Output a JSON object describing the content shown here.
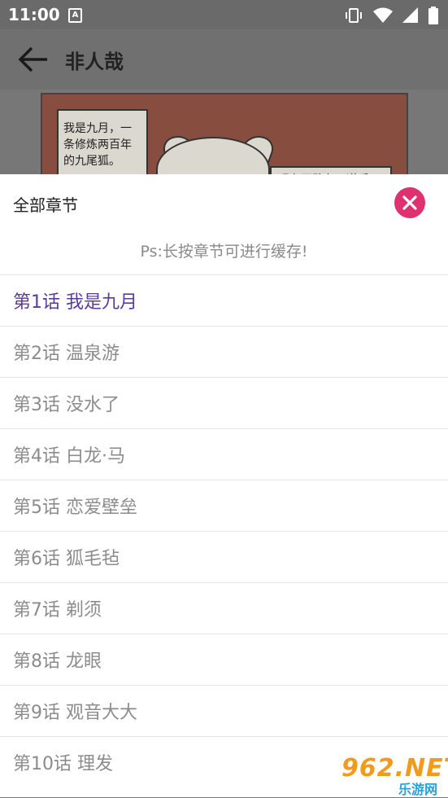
{
  "status_bar": {
    "time": "11:00",
    "notification_glyph": "A"
  },
  "app_bar": {
    "title": "非人哉"
  },
  "comic": {
    "bubble_lines": [
      "我是九月，一",
      "条修炼两百年",
      "的九尾狐。"
    ],
    "right_bubble_text": "现在不敢九天道后"
  },
  "sheet": {
    "title": "全部章节",
    "hint": "Ps:长按章节可进行缓存!",
    "chapters": [
      "第1话 我是九月",
      "第2话 温泉游",
      "第3话 没水了",
      "第4话 白龙·马",
      "第5话 恋爱壁垒",
      "第6话 狐毛毡",
      "第7话 剃须",
      "第8话 龙眼",
      "第9话 观音大大",
      "第10话 理发"
    ],
    "active_index": 0
  },
  "watermark": {
    "main": "962.NET",
    "sub": "乐游网"
  },
  "colors": {
    "accent_purple": "#5b3b9c",
    "close_pink": "#e0316f"
  },
  "icons": [
    "vibrate-icon",
    "wifi-icon",
    "signal-icon",
    "battery-icon",
    "back-arrow-icon",
    "close-icon"
  ]
}
